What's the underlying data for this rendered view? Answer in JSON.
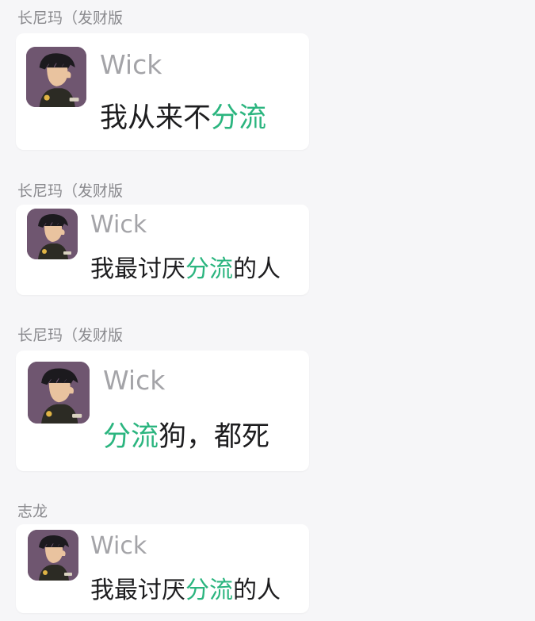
{
  "posts": [
    {
      "sender": "长尼玛（发财版",
      "card": {
        "avatar_icon": "anime-boy-avatar-icon",
        "nickname": "Wick",
        "message_before": "我从来不",
        "message_highlight": "分流",
        "message_after": ""
      }
    },
    {
      "sender": "长尼玛（发财版",
      "card": {
        "avatar_icon": "anime-boy-avatar-icon",
        "nickname": "Wick",
        "message_before": "我最讨厌",
        "message_highlight": "分流",
        "message_after": "的人"
      }
    },
    {
      "sender": "长尼玛（发财版",
      "card": {
        "avatar_icon": "anime-boy-avatar-icon",
        "nickname": "Wick",
        "message_before": "",
        "message_highlight": "分流",
        "message_after": "狗，都死"
      }
    },
    {
      "sender": "志龙",
      "card": {
        "avatar_icon": "anime-boy-avatar-icon",
        "nickname": "Wick",
        "message_before": "我最讨厌",
        "message_highlight": "分流",
        "message_after": "的人"
      }
    }
  ],
  "colors": {
    "background": "#f6f6f8",
    "card": "#ffffff",
    "sender_text": "#8a8a8e",
    "nickname_text": "#a4a4a8",
    "message_text": "#1d1d1f",
    "highlight": "#2bb57f",
    "avatar_bg": "#6f5670"
  }
}
